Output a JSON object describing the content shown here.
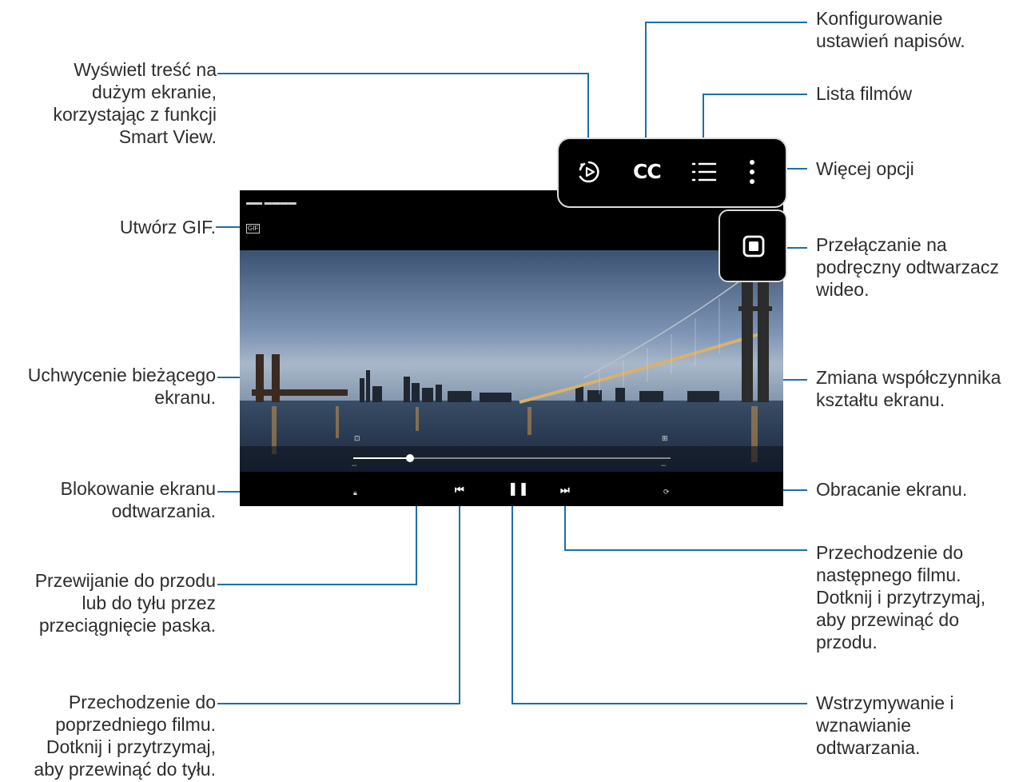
{
  "labels": {
    "smart_view": "Wyświetl treść na\ndużym ekranie,\nkorzystając z funkcji\nSmart View.",
    "gif": "Utwórz GIF.",
    "capture": "Uchwycenie bieżącego\nekranu.",
    "lock": "Blokowanie ekranu\nodtwarzania.",
    "seek": "Przewijanie do przodu\nlub do tyłu przez\nprzeciągnięcie paska.",
    "previous": "Przechodzenie do\npoprzedniego filmu.\nDotknij i przytrzymaj,\naby przewinąć do tyłu.",
    "subtitles": "Konfigurowanie\nustawień napisów.",
    "list": "Lista filmów",
    "more": "Więcej opcji",
    "popup_player": "Przełączanie na\npodręczny odtwarzacz\nwideo.",
    "aspect": "Zmiana współczynnika\nkształtu ekranu.",
    "rotate": "Obracanie ekranu.",
    "next": "Przechodzenie do\nnastępnego filmu.\nDotknij i przytrzymaj,\naby przewinąć do\nprzodu.",
    "pause": "Wstrzymywanie i\nwznawianie\nodtwarzania."
  },
  "player": {
    "cc_label": "CC",
    "gif_badge": "GIF",
    "progress": 0.18
  },
  "icons": {
    "smart_view": "smart-view-icon",
    "cc": "cc-icon",
    "list": "list-icon",
    "more": "more-vert-icon",
    "popup": "popup-player-icon",
    "capture": "capture-icon",
    "aspect": "aspect-ratio-icon",
    "lock": "lock-icon",
    "rotate": "rotate-icon",
    "prev": "previous-icon",
    "pause": "pause-icon",
    "next": "next-icon"
  },
  "colors": {
    "callout_line": "#1a6fa8",
    "border": "#dcdcdc"
  }
}
